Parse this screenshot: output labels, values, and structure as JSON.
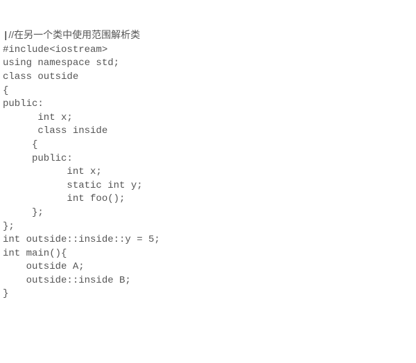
{
  "code": {
    "line1_cursor": "|",
    "line1_comment": "//在另一个类中使用范围解析类",
    "line2": "#include<iostream>",
    "line3": "using namespace std;",
    "line4": "",
    "line5": "class outside",
    "line6": "{",
    "line7": "public:",
    "line8": "      int x;",
    "line9": "      class inside",
    "line10": "     {",
    "line11": "     public:",
    "line12": "           int x;",
    "line13": "           static int y;",
    "line14": "           int foo();",
    "line15": "",
    "line16": "     };",
    "line17": "};",
    "line18": "int outside::inside::y = 5;",
    "line19": "",
    "line20": "int main(){",
    "line21": "    outside A;",
    "line22": "    outside::inside B;",
    "line23": "",
    "line24": "}"
  }
}
